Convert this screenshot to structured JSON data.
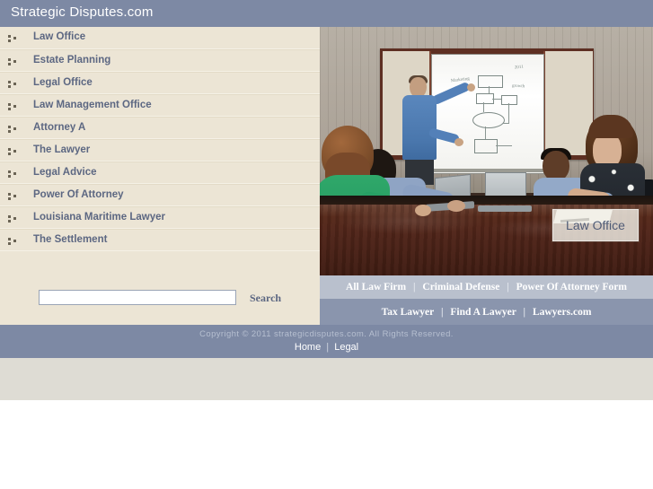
{
  "header": {
    "title": "Strategic Disputes.com",
    "bg_color": "#7d89a4"
  },
  "sidebar": {
    "bg_color": "#ece5d5",
    "bullet_icon": "three-dots-icon",
    "items": [
      {
        "label": "Law Office"
      },
      {
        "label": "Estate Planning"
      },
      {
        "label": "Legal Office"
      },
      {
        "label": "Law Management Office"
      },
      {
        "label": "Attorney A"
      },
      {
        "label": "The Lawyer"
      },
      {
        "label": "Legal Advice"
      },
      {
        "label": "Power Of Attorney"
      },
      {
        "label": "Louisiana Maritime Lawyer"
      },
      {
        "label": "The Settlement"
      }
    ]
  },
  "search": {
    "value": "",
    "placeholder": "",
    "label": "Search"
  },
  "hero": {
    "caption": "Law Office",
    "alt": "business meeting, man presenting diagram on whiteboard to colleagues at conference table",
    "whiteboard_scrawl": [
      "Marketing",
      "2011",
      "growth"
    ]
  },
  "linkbar_top": {
    "bg_color": "#b9c0cd",
    "separator": "|",
    "links": [
      "All Law Firm",
      "Criminal Defense",
      "Power Of Attorney Form"
    ]
  },
  "linkbar_bottom": {
    "bg_color": "#8a95ad",
    "separator": "|",
    "links": [
      "Tax Lawyer",
      "Find A Lawyer",
      "Lawyers.com"
    ]
  },
  "footer": {
    "bg_color": "#7d89a4",
    "copyright": "Copyright © 2011 strategicdisputes.com. All Rights Reserved.",
    "separator": "|",
    "links": [
      "Home",
      "Legal"
    ]
  },
  "bottom_band": {
    "bg_color": "#dedcd4"
  }
}
